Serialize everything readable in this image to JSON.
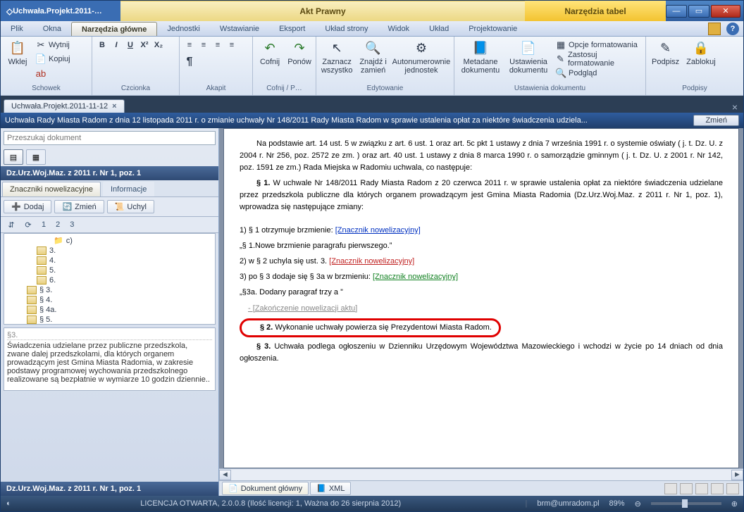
{
  "title": {
    "left": "Uchwała.Projekt.2011-…",
    "center": "Akt Prawny",
    "right": "Narzędzia tabel"
  },
  "menu": {
    "items": [
      "Plik",
      "Okna",
      "Narzędzia główne",
      "Jednostki",
      "Wstawianie",
      "Eksport",
      "Układ strony",
      "Widok",
      "Układ",
      "Projektowanie"
    ],
    "active": 2
  },
  "ribbon": {
    "groups": [
      {
        "label": "Schowek",
        "items": [
          {
            "name": "paste",
            "label": "Wklej",
            "icon": "📋",
            "big": true
          },
          {
            "name": "cut",
            "label": "Wytnij",
            "icon": "✂",
            "small": true
          },
          {
            "name": "copy",
            "label": "Kopiuj",
            "icon": "📄",
            "small": true
          }
        ]
      },
      {
        "label": "Czcionka"
      },
      {
        "label": "Akapit"
      },
      {
        "label": "Cofnij / P…",
        "items": [
          {
            "name": "undo",
            "label": "Cofnij",
            "icon": "↶",
            "big": true
          },
          {
            "name": "redo",
            "label": "Ponów",
            "icon": "↷",
            "big": true
          }
        ]
      },
      {
        "label": "Edytowanie",
        "items": [
          {
            "name": "select-all",
            "label": "Zaznacz wszystko",
            "icon": "↖",
            "big": true
          },
          {
            "name": "find-replace",
            "label": "Znajdź i zamień",
            "icon": "🔍",
            "big": true
          },
          {
            "name": "autonum",
            "label": "Autonumerownie jednostek",
            "icon": "⚙",
            "big": true
          }
        ]
      },
      {
        "label": "Ustawienia dokumentu",
        "items": [
          {
            "name": "doc-meta",
            "label": "Metadane dokumentu",
            "icon": "📘",
            "big": true
          },
          {
            "name": "doc-settings",
            "label": "Ustawienia dokumentu",
            "icon": "📄",
            "big": true
          },
          {
            "name": "fmt-opts",
            "label": "Opcje formatowania",
            "icon": "▦",
            "small": true
          },
          {
            "name": "apply-fmt",
            "label": "Zastosuj formatowanie",
            "icon": "✎",
            "small": true
          },
          {
            "name": "preview",
            "label": "Podgląd",
            "icon": "🔍",
            "small": true
          }
        ]
      },
      {
        "label": "Podpisy",
        "items": [
          {
            "name": "sign",
            "label": "Podpisz",
            "icon": "✎",
            "big": true
          },
          {
            "name": "lock",
            "label": "Zablokuj",
            "icon": "🔒",
            "big": true
          }
        ]
      }
    ]
  },
  "doc_tab": {
    "title": "Uchwała.Projekt.2011-11-12"
  },
  "infobar": {
    "text": "Uchwała Rady Miasta Radom z dnia 12 listopada 2011 r. o zmianie uchwały Nr 148/2011 Rady Miasta Radom w sprawie ustalenia opłat za niektóre świadczenia udziela...",
    "btn": "Zmień"
  },
  "search": {
    "placeholder": "Przeszukaj dokument"
  },
  "side": {
    "panel1": "Dz.Urz.Woj.Maz. z 2011 r. Nr 1, poz. 1",
    "panel2": "Dz.Urz.Woj.Maz. z 2011 r. Nr 1, poz. 1",
    "tabs": [
      "Znaczniki nowelizacyjne",
      "Informacje"
    ],
    "actions": [
      {
        "label": "Dodaj",
        "icon": "➕"
      },
      {
        "label": "Zmień",
        "icon": "🔄"
      },
      {
        "label": "Uchyl",
        "icon": "📜"
      }
    ],
    "pages": [
      "1",
      "2",
      "3"
    ],
    "tree": [
      {
        "label": "c)",
        "lv": 3,
        "kind": "folder"
      },
      {
        "label": "3.",
        "lv": 2,
        "kind": "item"
      },
      {
        "label": "4.",
        "lv": 2,
        "kind": "item"
      },
      {
        "label": "5.",
        "lv": 2,
        "kind": "item"
      },
      {
        "label": "6.",
        "lv": 2,
        "kind": "item"
      },
      {
        "label": "§ 3.",
        "lv": 1,
        "kind": "item"
      },
      {
        "label": "§ 4.",
        "lv": 1,
        "kind": "item"
      },
      {
        "label": "§ 4a.",
        "lv": 1,
        "kind": "item"
      },
      {
        "label": "§ 5.",
        "lv": 1,
        "kind": "item"
      }
    ],
    "note_title": "§3.",
    "note_text": "Świadczenia udzielane przez publiczne przedszkola, zwane dalej przedszkolami, dla których organem prowadzącym jest Gmina Miasta Radomia, w zakresie podstawy programowej wychowania przedszkolnego realizowane są bezpłatnie w wymiarze 10 godzin dziennie.."
  },
  "document": {
    "p1": "Na podstawie art. 14 ust. 5 w związku z art. 6 ust. 1 oraz art. 5c pkt 1 ustawy z dnia 7 września 1991 r. o systemie oświaty ( j. t. Dz. U. z 2004 r. Nr 256, poz. 2572 ze zm. ) oraz art. 40 ust. 1 ustawy z dnia 8 marca 1990 r. o samorządzie gminnym ( j. t. Dz. U. z 2001 r. Nr 142, poz. 1591 ze zm.) Rada Miejska w Radomiu uchwala, co następuje:",
    "p2a": "§ 1.",
    "p2b": " W uchwale Nr 148/2011 Rady Miasta Radom z 20 czerwca 2011 r. w sprawie ustalenia opłat za niektóre świadczenia udzielane przez przedszkola publiczne dla których organem prowadzącym jest Gmina Miasta Radomia (Dz.Urz.Woj.Maz. z 2011 r. Nr 1, poz. 1), wprowadza się następujące zmiany:",
    "l1a": "1) § 1 otrzymuje brzmienie: ",
    "l1b": "[Znacznik nowelizacyjny]",
    "l2": "„§ 1.Nowe brzmienie paragrafu pierwszego.”",
    "l3a": "2) w § 2  uchyla się ust. 3. ",
    "l3b": "[Znacznik nowelizacyjny]",
    "l4a": "3) po § 3 dodaje się § 3a w brzmieniu: ",
    "l4b": "[Znacznik nowelizacyjny]",
    "l5": "„§3a. Dodany paragraf trzy a ”",
    "l6": "-   [Zakończenie nowelizacji aktu]",
    "hl_a": "§ 2.",
    "hl_b": " Wykonanie uchwały powierza się Prezydentowi Miasta Radom.",
    "p3a": "§ 3.",
    "p3b": " Uchwała podlega ogłoszeniu w Dzienniku Urzędowym Województwa Mazowieckiego i wchodzi w życie po 14 dniach od dnia ogłoszenia."
  },
  "bottom_tabs": [
    {
      "label": "Dokument główny",
      "icon": "📄"
    },
    {
      "label": "XML",
      "icon": "📘"
    }
  ],
  "status": {
    "license": "LICENCJA OTWARTA, 2.0.0.8 (Ilość licencji: 1, Ważna do 26 sierpnia 2012)",
    "email": "brm@umradom.pl",
    "zoom": "89%"
  }
}
